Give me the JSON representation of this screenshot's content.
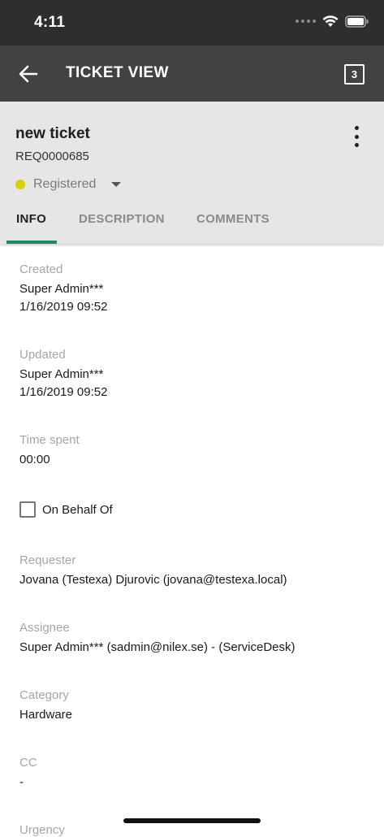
{
  "status_bar": {
    "time": "4:11"
  },
  "app_bar": {
    "title": "TICKET VIEW",
    "badge_count": "3"
  },
  "ticket": {
    "title": "new ticket",
    "id": "REQ0000685",
    "status": "Registered",
    "status_color": "#d6d400"
  },
  "tabs": [
    {
      "label": "INFO",
      "active": true
    },
    {
      "label": "DESCRIPTION",
      "active": false
    },
    {
      "label": "COMMENTS",
      "active": false
    }
  ],
  "accent_color": "#1b8a6b",
  "fields": {
    "created": {
      "label": "Created",
      "user": "Super Admin***",
      "date": "1/16/2019 09:52"
    },
    "updated": {
      "label": "Updated",
      "user": "Super Admin***",
      "date": "1/16/2019 09:52"
    },
    "time_spent": {
      "label": "Time spent",
      "value": "00:00"
    },
    "on_behalf_of": {
      "label": "On Behalf Of",
      "checked": false
    },
    "requester": {
      "label": "Requester",
      "value": "Jovana (Testexa) Djurovic (jovana@testexa.local)"
    },
    "assignee": {
      "label": "Assignee",
      "value": "Super Admin*** (sadmin@nilex.se) - (ServiceDesk)"
    },
    "category": {
      "label": "Category",
      "value": "Hardware"
    },
    "cc": {
      "label": "CC",
      "value": "-"
    },
    "urgency": {
      "label": "Urgency"
    }
  },
  "icons": {
    "back": "arrow-left-icon",
    "more": "more-vertical-icon",
    "wifi": "wifi-icon",
    "battery": "battery-icon",
    "signal": "signal-icon",
    "caret": "caret-down-icon"
  }
}
